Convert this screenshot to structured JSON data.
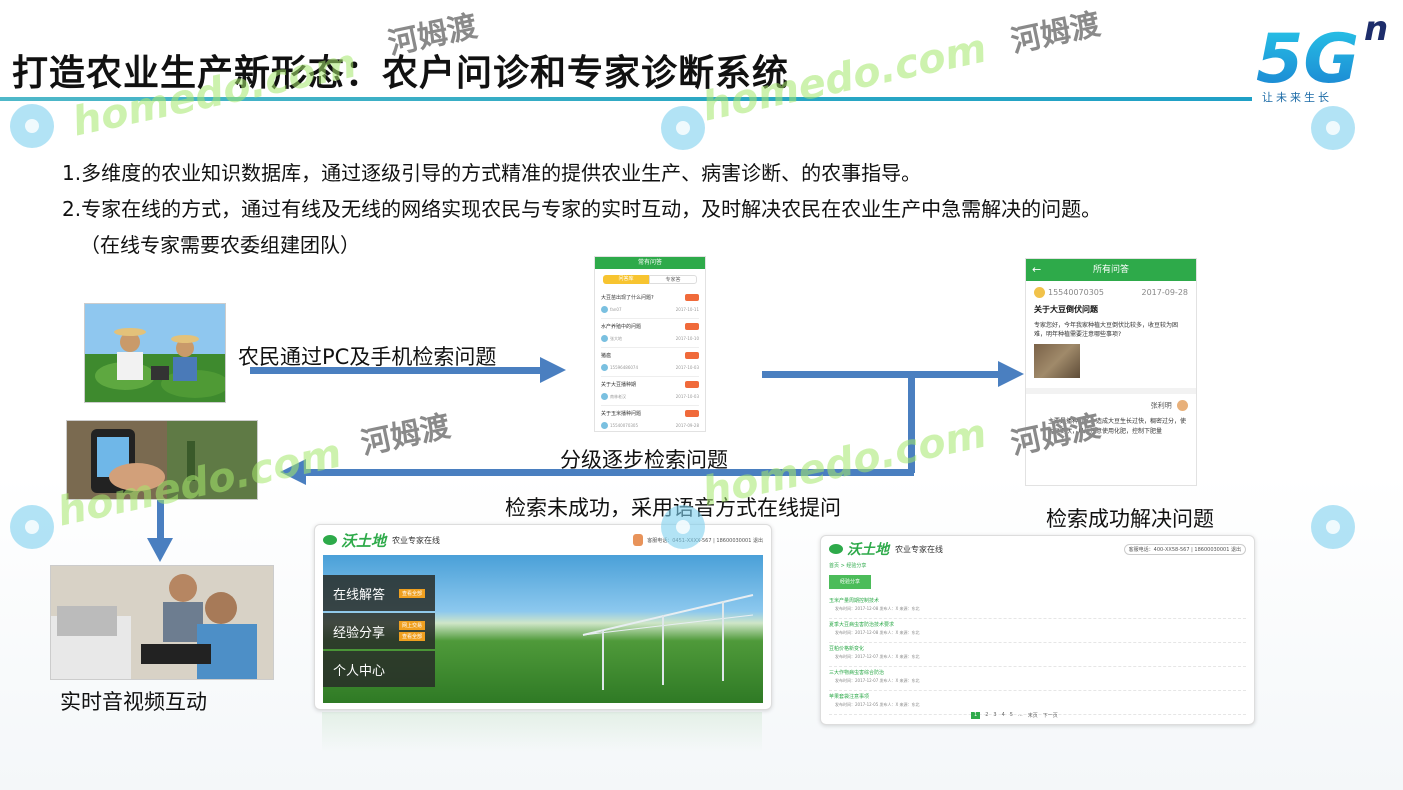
{
  "title": "打造农业生产新形态：农户问诊和专家诊断系统",
  "logo": {
    "brand": "5G",
    "superscript": "n",
    "slogan": "让未来生长"
  },
  "bullets": [
    "1.多维度的农业知识数据库，通过逐级引导的方式精准的提供农业生产、病害诊断、的农事指导。",
    "2.专家在线的方式，通过有线及无线的网络实现农民与专家的实时互动，及时解决农民在农业生产中急需解决的问题。",
    "（在线专家需要农委组建团队）"
  ],
  "flow_labels": {
    "search_pc_phone": "农民通过PC及手机检索问题",
    "stepwise": "分级逐步检索问题",
    "fail_voice": "检索未成功，采用语音方式在线提问",
    "success": "检索成功解决问题",
    "av_interaction": "实时音视频互动"
  },
  "phone_left": {
    "header": "常有问答",
    "tabs": [
      "问答库",
      "专家答"
    ],
    "items": [
      {
        "title": "大豆苗出现了什么问题?",
        "user": "fan07",
        "date": "2017-10-11"
      },
      {
        "title": "水产养殖中的问题",
        "user": "张大地",
        "date": "2017-10-10"
      },
      {
        "title": "猪瘟",
        "user": "15596486074",
        "date": "2017-10-03"
      },
      {
        "title": "关于大豆播种期",
        "user": "南林老汉",
        "date": "2017-10-03"
      },
      {
        "title": "关于玉米播种问题",
        "user": "15540070305",
        "date": "2017-09-28"
      }
    ]
  },
  "phone_right": {
    "header": "所有问答",
    "user": "15540070305",
    "date": "2017-09-28",
    "question_title": "关于大豆倒伏问题",
    "question_body": "专家您好，今年我家种植大豆倒伏比较多，收豆较为困难，明年种植需要注意哪些事项?",
    "expert": "张利明",
    "answer_body": "主要是播种过多，造成大豆生长过快，稠密过分，使大豆倒伏，以后注意使用化肥，控制下肥量"
  },
  "web_left": {
    "brand": "沃土地",
    "subtitle": "农业专家在线",
    "user_info": "客服电话：0451-XXXX-567 | 18600030001 退出",
    "menu": [
      {
        "label": "在线解答",
        "badges": [
          "查看全部"
        ]
      },
      {
        "label": "经验分享",
        "badges": [
          "网上交易",
          "查看全部"
        ]
      },
      {
        "label": "个人中心",
        "badges": []
      }
    ]
  },
  "web_right": {
    "brand": "沃土地",
    "subtitle": "农业专家在线",
    "user_info": "客服电话：400-XX58-567 | 18600030001 退出",
    "breadcrumb": "首页 > 经验分享",
    "tab": "经验分享",
    "rows": [
      {
        "title": "玉米产量周期控制技术",
        "meta": "发布时间：2017-12-08  发布人：X  来源：东北"
      },
      {
        "title": "夏季大豆病虫害防治技术要求",
        "meta": "发布时间：2017-12-08  发布人：X  来源：东北"
      },
      {
        "title": "豆粕价格新变化",
        "meta": "发布时间：2017-12-07  发布人：X  来源：东北"
      },
      {
        "title": "三大作物病虫害综合防治",
        "meta": "发布时间：2017-12-07  发布人：X  来源：东北"
      },
      {
        "title": "苹果套袋注意事项",
        "meta": "发布时间：2017-12-05  发布人：X  来源：东北"
      }
    ],
    "pagination": [
      "1",
      "2",
      "3",
      "4",
      "5",
      "...",
      "末页",
      "下一页"
    ]
  },
  "watermark": {
    "latin": "homedo.com",
    "cn": "河姆渡"
  },
  "colors": {
    "title_line": "#2aa7c3",
    "arrow": "#4a7fc0",
    "green": "#2eaa4a",
    "dark_menu": "#2a2f2a",
    "orange_badge": "#f0a020"
  }
}
